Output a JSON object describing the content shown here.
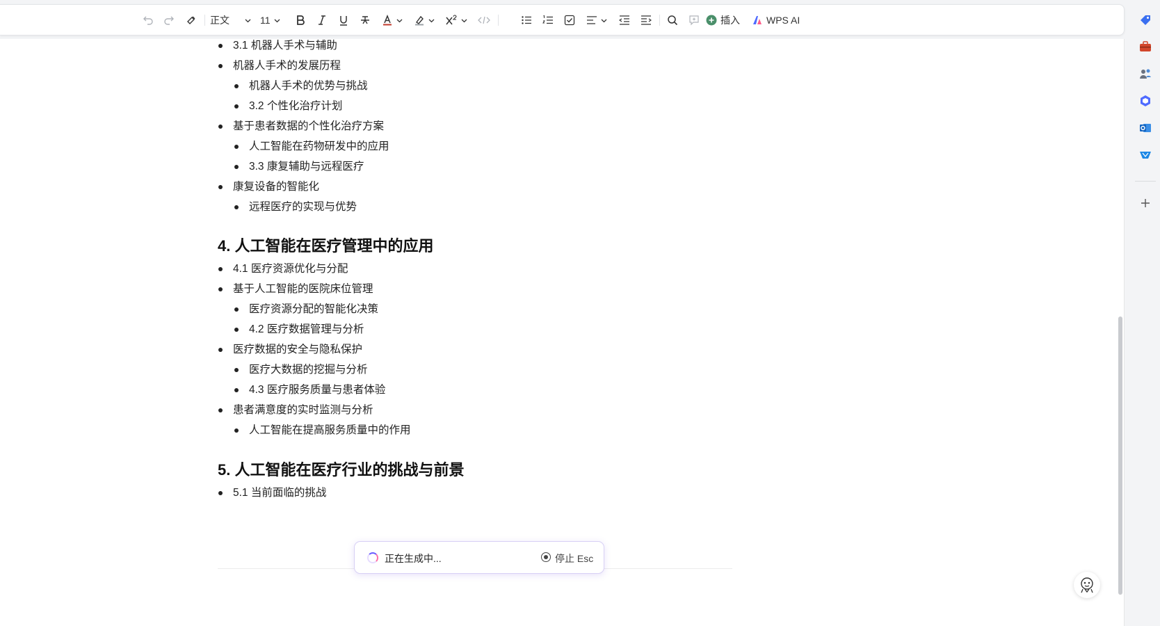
{
  "toolbar": {
    "style_value": "正文",
    "font_size_value": "11",
    "insert_label": "插入",
    "wps_ai_label": "WPS AI"
  },
  "document": {
    "items": [
      "3.1 机器人手术与辅助",
      "机器人手术的发展历程",
      "机器人手术的优势与挑战",
      "3.2 个性化治疗计划",
      "基于患者数据的个性化治疗方案",
      "人工智能在药物研发中的应用",
      "3.3 康复辅助与远程医疗",
      "康复设备的智能化",
      "远程医疗的实现与优势",
      "4. 人工智能在医疗管理中的应用",
      "4.1 医疗资源优化与分配",
      "基于人工智能的医院床位管理",
      "医疗资源分配的智能化决策",
      "4.2 医疗数据管理与分析",
      "医疗数据的安全与隐私保护",
      "医疗大数据的挖掘与分析",
      "4.3 医疗服务质量与患者体验",
      "患者满意度的实时监测与分析",
      "人工智能在提高服务质量中的作用",
      "5. 人工智能在医疗行业的挑战与前景",
      "5.1 当前面临的挑战"
    ]
  },
  "generating": {
    "status_text": "正在生成中...",
    "stop_label": "停止 Esc"
  },
  "colors": {
    "accent": "#6a5cff",
    "insert_icon": "#4a8f6a"
  }
}
